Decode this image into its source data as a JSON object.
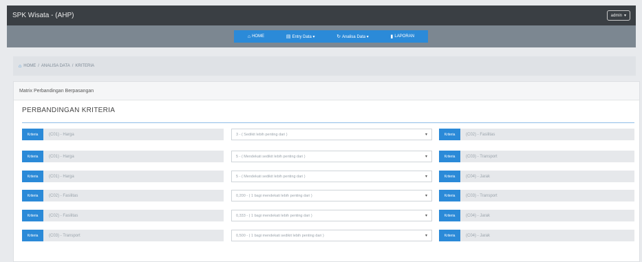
{
  "app": {
    "title": "SPK Wisata - (AHP)",
    "admin_label": "admin"
  },
  "nav": {
    "items": [
      {
        "icon": "home-icon",
        "label": "HOME"
      },
      {
        "icon": "database-icon",
        "label": "Entry Data ▾"
      },
      {
        "icon": "refresh-icon",
        "label": "Analisa Data ▾"
      },
      {
        "icon": "document-icon",
        "label": "LAPORAN"
      }
    ]
  },
  "breadcrumb": [
    "HOME",
    "ANALISA DATA",
    "KRITERIA"
  ],
  "panel": {
    "heading": "Matrix Perbandingan Berpasangan",
    "section_title": "PERBANDINGAN KRITERIA",
    "tag_label": "Kriteria",
    "rows": [
      {
        "left": "(C01) - Harga",
        "choice": "3 - ( Sedikit lebih penting dari )",
        "right": "(C02) - Fasilitas"
      },
      {
        "left": "(C01) - Harga",
        "choice": "5 - ( Mendekati sedikit lebih penting dari )",
        "right": "(C03) - Transport"
      },
      {
        "left": "(C01) - Harga",
        "choice": "5 - ( Mendekati sedikit lebih penting dari )",
        "right": "(C04) - Jarak"
      },
      {
        "left": "(C02) - Fasilitas",
        "choice": "0,200 - ( 1 bagi mendekati lebih penting dari )",
        "right": "(C03) - Transport"
      },
      {
        "left": "(C02) - Fasilitas",
        "choice": "0,333 - ( 1 bagi mendekati lebih penting dari )",
        "right": "(C04) - Jarak"
      },
      {
        "left": "(C03) - Transport",
        "choice": "0,500 - ( 1 bagi mendekati sedikit lebih penting dari )",
        "right": "(C04) - Jarak"
      }
    ]
  }
}
